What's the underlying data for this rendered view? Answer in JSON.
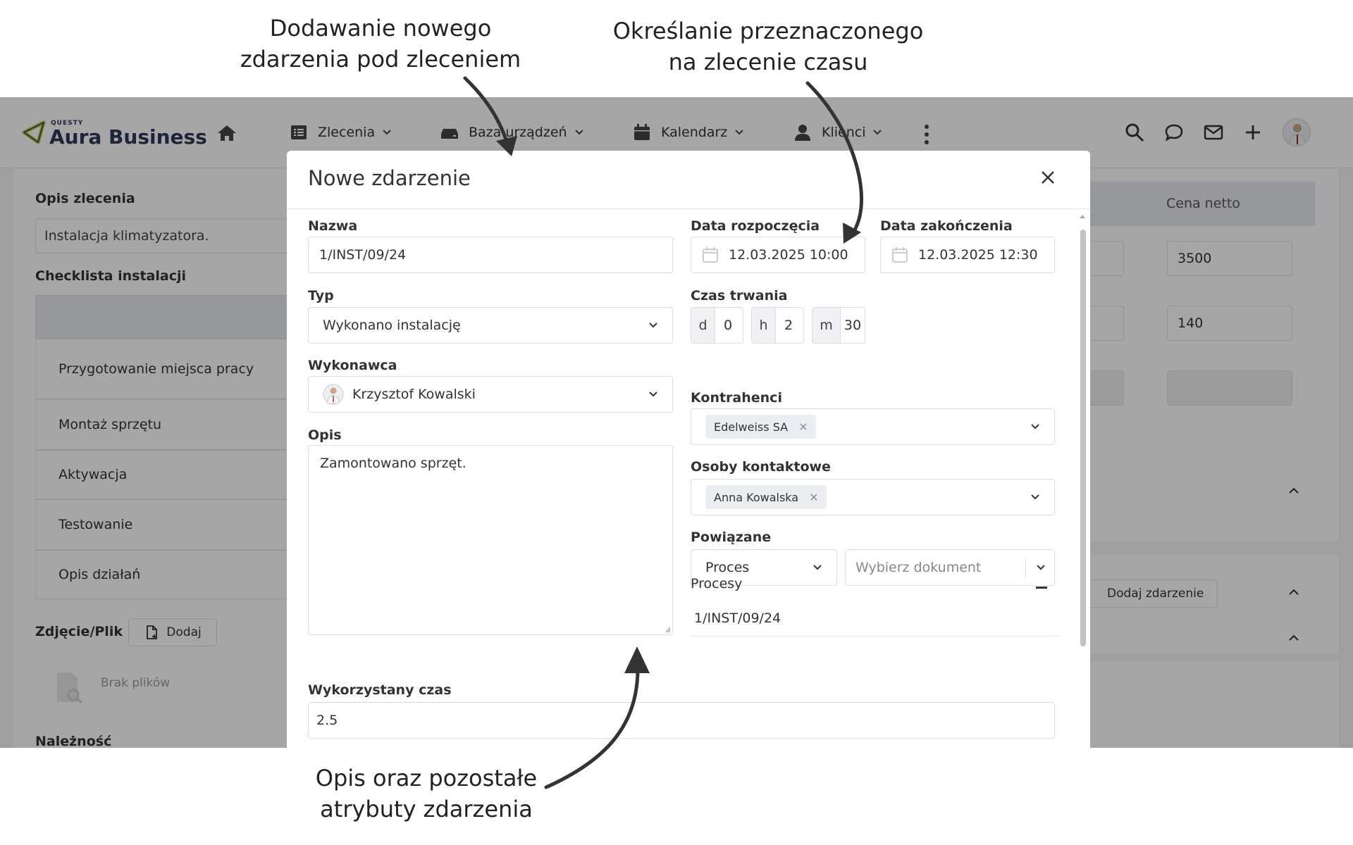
{
  "annotations": {
    "top_left": [
      "Dodawanie nowego",
      "zdarzenia pod zleceniem"
    ],
    "top_right": [
      "Określanie przeznaczonego",
      "na zlecenie czasu"
    ],
    "bottom": [
      "Opis oraz pozostałe",
      "atrybuty zdarzenia"
    ]
  },
  "navbar": {
    "brand_small": "QUESTY",
    "brand_name": "Aura Business",
    "items": [
      {
        "label": "Zlecenia",
        "icon": "list-icon"
      },
      {
        "label": "Baza urządzeń",
        "icon": "devices-icon"
      },
      {
        "label": "Kalendarz",
        "icon": "calendar-icon"
      },
      {
        "label": "Klienci",
        "icon": "user-icon"
      }
    ],
    "right_icons": [
      "search-icon",
      "chat-icon",
      "mail-icon",
      "plus-icon",
      "avatar"
    ]
  },
  "background_page": {
    "opis_label": "Opis zlecenia",
    "opis_value": "Instalacja klimatyzatora.",
    "checklist_label": "Checklista instalacji",
    "checklist_items": [
      "Przygotowanie miejsca pracy",
      "Montaż sprzętu",
      "Aktywacja",
      "Testowanie",
      "Opis działań"
    ],
    "files_label": "Zdjęcie/Plik",
    "add_button": "Dodaj",
    "no_files": "Brak plików",
    "naleznosc_label": "Należność",
    "price_header": "Cena netto",
    "prices": [
      "3500",
      "140",
      ""
    ],
    "add_event_button": "Dodaj zdarzenie"
  },
  "modal": {
    "title": "Nowe zdarzenie",
    "nazwa_label": "Nazwa",
    "nazwa_value": "1/INST/09/24",
    "typ_label": "Typ",
    "typ_value": "Wykonano instalację",
    "wykonawca_label": "Wykonawca",
    "wykonawca_value": "Krzysztof Kowalski",
    "opis_label": "Opis",
    "opis_value": "Zamontowano sprzęt.",
    "start_label": "Data rozpoczęcia",
    "start_value": "12.03.2025 10:00",
    "end_label": "Data zakończenia",
    "end_value": "12.03.2025 12:30",
    "duration_label": "Czas trwania",
    "duration": {
      "d_unit": "d",
      "d_value": "0",
      "h_unit": "h",
      "h_value": "2",
      "m_unit": "m",
      "m_value": "30"
    },
    "kontrahenci_label": "Kontrahenci",
    "kontrahenci_chip": "Edelweiss SA",
    "osoby_label": "Osoby kontaktowe",
    "osoby_chip": "Anna Kowalska",
    "powiazane_label": "Powiązane",
    "powiazane_type": "Proces",
    "powiazane_doc_placeholder": "Wybierz dokument",
    "procesy_label": "Procesy",
    "procesy_item": "1/INST/09/24",
    "wykorzystany_label": "Wykorzystany czas",
    "wykorzystany_value": "2.5"
  },
  "colors": {
    "overlay": "#00000059",
    "brand_accent": "#b8c43a",
    "brand_text": "#2b3a58",
    "arrow": "#333333"
  }
}
